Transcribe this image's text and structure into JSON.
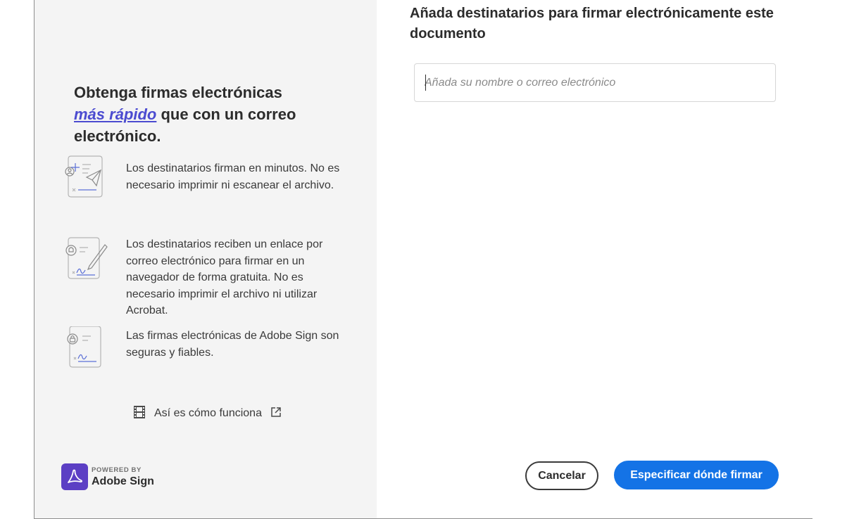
{
  "left": {
    "headline": {
      "line_start": "Obtenga firmas electrónicas",
      "accent": "más rápido",
      "line_end": " que con un correo electrónico."
    },
    "features": [
      {
        "icon": "send-document-icon",
        "text": "Los destinatarios firman en minutos. No es necesario imprimir ni escanear el archivo."
      },
      {
        "icon": "signature-link-icon",
        "text": "Los destinatarios reciben un enlace por correo electrónico para firmar en un navegador de forma gratuita. No es necesario imprimir el archivo ni utilizar Acrobat."
      },
      {
        "icon": "secure-document-icon",
        "text": "Las firmas electrónicas de Adobe Sign son seguras y fiables."
      }
    ],
    "how_it_works": {
      "label": "Así es cómo funciona",
      "icon": "film-icon",
      "link_icon": "external-link-icon"
    },
    "brand": {
      "powered_by": "POWERED BY",
      "product": "Adobe Sign",
      "logo_color": "#5c3fc4"
    }
  },
  "right": {
    "title": "Añada destinatarios para firmar electrónicamente este documento",
    "recipient_input": {
      "value": "",
      "placeholder": "Añada su nombre o correo electrónico"
    },
    "buttons": {
      "cancel": "Cancelar",
      "primary": "Especificar dónde firmar"
    },
    "colors": {
      "primary": "#1473e6",
      "accent_text": "#4b4bd0"
    }
  }
}
